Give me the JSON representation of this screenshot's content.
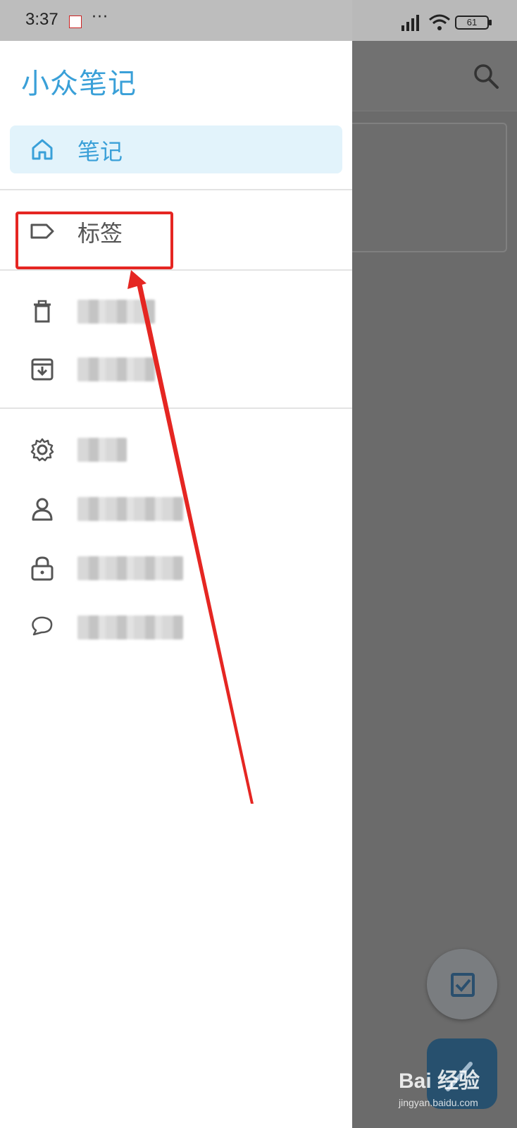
{
  "status_bar": {
    "time": "3:37",
    "more": "···",
    "battery": "61"
  },
  "drawer": {
    "title": "小众笔记",
    "items": [
      {
        "label": "笔记",
        "icon": "home-icon",
        "active": true
      },
      {
        "label": "标签",
        "icon": "label-icon"
      },
      {
        "label": "",
        "icon": "trash-icon"
      },
      {
        "label": "",
        "icon": "archive-icon"
      },
      {
        "label": "",
        "icon": "gear-icon"
      },
      {
        "label": "",
        "icon": "user-icon"
      },
      {
        "label": "",
        "icon": "lock-icon"
      },
      {
        "label": "",
        "icon": "chat-icon"
      }
    ]
  },
  "colors": {
    "accent": "#3aa0d8",
    "active_bg": "#e2f3fb",
    "annotation": "#e52622"
  },
  "watermark": {
    "brand": "Bai 经验",
    "url": "jingyan.baidu.com"
  }
}
